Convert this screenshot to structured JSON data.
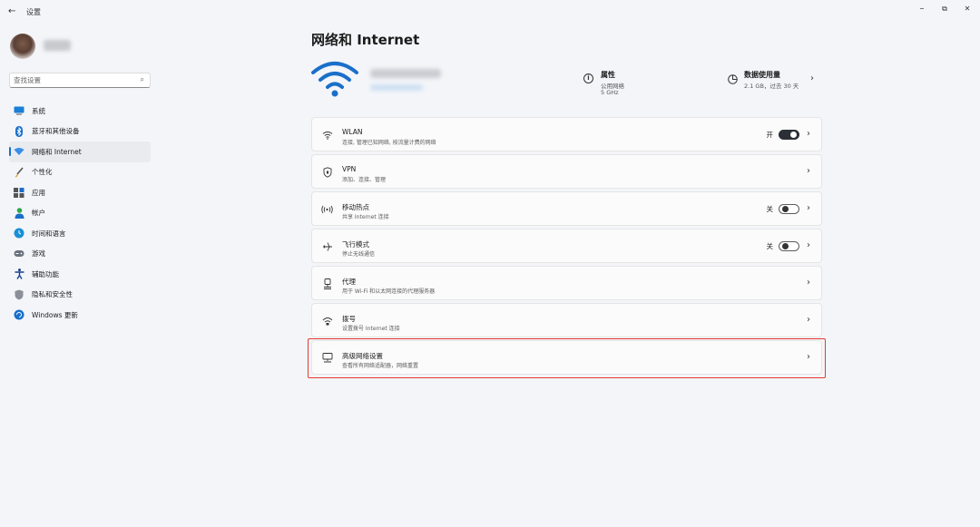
{
  "window": {
    "title": "设置",
    "back": "←",
    "controls": {
      "minimize": "–",
      "restore": "⧉",
      "close": "✕"
    }
  },
  "sidebar": {
    "search_placeholder": "查找设置",
    "items": [
      {
        "label": "系统",
        "icon": "monitor-icon"
      },
      {
        "label": "蓝牙和其他设备",
        "icon": "bluetooth-icon"
      },
      {
        "label": "网络和 Internet",
        "icon": "wifi-diamond-icon",
        "active": true
      },
      {
        "label": "个性化",
        "icon": "brush-icon"
      },
      {
        "label": "应用",
        "icon": "apps-icon"
      },
      {
        "label": "帐户",
        "icon": "person-icon"
      },
      {
        "label": "时间和语言",
        "icon": "globe-clock-icon"
      },
      {
        "label": "游戏",
        "icon": "gamepad-icon"
      },
      {
        "label": "辅助功能",
        "icon": "accessibility-icon"
      },
      {
        "label": "隐私和安全性",
        "icon": "shield-icon"
      },
      {
        "label": "Windows 更新",
        "icon": "update-icon"
      }
    ]
  },
  "main": {
    "title": "网络和 Internet",
    "properties": {
      "title": "属性",
      "line1": "公用网络",
      "line2": "5 GHz"
    },
    "data_usage": {
      "title": "数据使用量",
      "line1": "2.1 GB，过去 30 天"
    },
    "cards": [
      {
        "title": "WLAN",
        "subtitle": "连接, 管理已知网络, 按流量计费的网络",
        "icon": "wifi-icon",
        "toggle": "开",
        "toggle_on": true
      },
      {
        "title": "VPN",
        "subtitle": "添加、连接、管理",
        "icon": "vpn-shield-icon"
      },
      {
        "title": "移动热点",
        "subtitle": "共享 Internet 连接",
        "icon": "hotspot-icon",
        "toggle": "关",
        "toggle_on": false
      },
      {
        "title": "飞行模式",
        "subtitle": "停止无线通信",
        "icon": "airplane-icon",
        "toggle": "关",
        "toggle_on": false
      },
      {
        "title": "代理",
        "subtitle": "用于 Wi-Fi 和以太网连接的代理服务器",
        "icon": "proxy-icon"
      },
      {
        "title": "拨号",
        "subtitle": "设置拨号 Internet 连接",
        "icon": "dialup-icon"
      },
      {
        "title": "高级网络设置",
        "subtitle": "查看所有网络适配器，网络重置",
        "icon": "advanced-network-icon"
      }
    ]
  },
  "colors": {
    "accent": "#1a6fc9",
    "highlight": "#e53935",
    "background": "#f3f5f9"
  }
}
